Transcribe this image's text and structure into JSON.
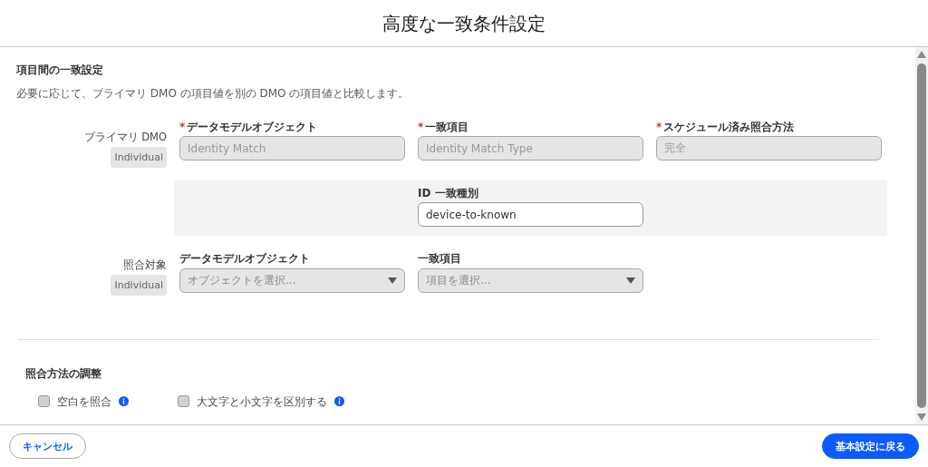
{
  "dialog": {
    "title": "高度な一致条件設定"
  },
  "match_section": {
    "title": "項目間の一致設定",
    "description": "必要に応じて、プライマリ DMO の項目値を別の DMO の項目値と比較します。",
    "primary": {
      "label": "プライマリ DMO",
      "badge": "Individual",
      "fields": [
        {
          "label": "データモデルオブジェクト",
          "required_mark": "*",
          "kind": "text",
          "value": "Identity Match",
          "disabled": true
        },
        {
          "label": "一致項目",
          "required_mark": "*",
          "kind": "text",
          "value": "Identity Match Type",
          "disabled": true
        },
        {
          "label": "スケジュール済み照合方法",
          "required_mark": "*",
          "kind": "text",
          "value": "完全",
          "disabled": true
        }
      ]
    },
    "id_type": {
      "label": "ID 一致種別",
      "kind": "text",
      "value": "device-to-known",
      "disabled": false
    },
    "target": {
      "label": "照合対象",
      "badge": "Individual",
      "fields": [
        {
          "label": "データモデルオブジェクト",
          "kind": "select",
          "placeholder": "オブジェクトを選択...",
          "disabled": true
        },
        {
          "label": "一致項目",
          "kind": "select",
          "placeholder": "項目を選択...",
          "disabled": true
        }
      ]
    }
  },
  "adjust_section": {
    "title": "照合方法の調整",
    "options": [
      {
        "label": "空白を照合",
        "checked": false,
        "info": true
      },
      {
        "label": "大文字と小文字を区別する",
        "checked": false,
        "info": true
      }
    ]
  },
  "footer": {
    "cancel": "キャンセル",
    "primary": "基本設定に戻る"
  }
}
